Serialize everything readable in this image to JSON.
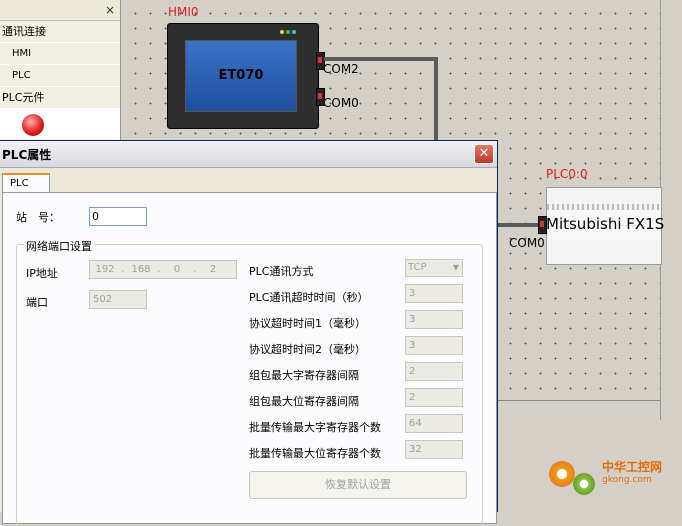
{
  "left_panel": {
    "close_glyph": "×",
    "items": [
      {
        "label": "通讯连接"
      },
      {
        "label": "HMI"
      },
      {
        "label": "PLC"
      },
      {
        "label": "PLC元件"
      }
    ]
  },
  "canvas": {
    "hmi": {
      "label": "HMI0",
      "screen_text": "ET070",
      "ports": [
        "COM2",
        "COM0"
      ]
    },
    "plc": {
      "label": "PLC0:0",
      "name": "Mitsubishi FX1S",
      "port": "COM0"
    }
  },
  "dialog": {
    "title": "PLC属性",
    "close_glyph": "✕",
    "tab": "PLC",
    "station": {
      "label": "站　号：",
      "value": "0"
    },
    "group_title": "网络端口设置",
    "ip": {
      "label": "IP地址",
      "segments": [
        "192",
        "168",
        "0",
        "2"
      ]
    },
    "port": {
      "label": "端口",
      "value": "502"
    },
    "fields": [
      {
        "label": "PLC通讯方式",
        "value": "TCP"
      },
      {
        "label": "PLC通讯超时时间（秒）",
        "value": "3"
      },
      {
        "label": "协议超时时间1（毫秒）",
        "value": "3"
      },
      {
        "label": "协议超时时间2（毫秒）",
        "value": "3"
      },
      {
        "label": "组包最大字寄存器间隔",
        "value": "2"
      },
      {
        "label": "组包最大位寄存器间隔",
        "value": "2"
      },
      {
        "label": "批量传输最大字寄存器个数",
        "value": "64"
      },
      {
        "label": "批量传输最大位寄存器个数",
        "value": "32"
      }
    ],
    "restore_button": "恢复默认设置"
  },
  "watermark": {
    "line1": "中华工控网",
    "line2": "gkong.com"
  },
  "colors": {
    "device_label": "#dd2222",
    "dialog_border": "#0a246a",
    "watermark": "#e36c0a"
  }
}
